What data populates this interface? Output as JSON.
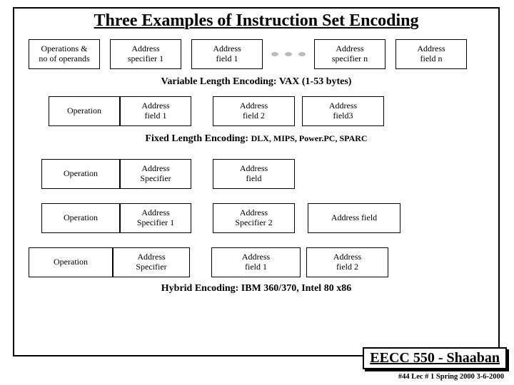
{
  "title_a": "Three Exam",
  "title_b": "ples of Instruction Set Encodin",
  "title_c": "g",
  "row1": {
    "c1a": "Operations &",
    "c1b": "no of operands",
    "c2a": "Address",
    "c2b": "specifier 1",
    "c3a": "Address",
    "c3b": "field 1",
    "c4a": "Address",
    "c4b": "specifier n",
    "c5a": "Address",
    "c5b": "field n"
  },
  "sub1": "Variable Length Encoding:  VAX  (1-53 bytes)",
  "row2": {
    "c1": "Operation",
    "c2a": "Address",
    "c2b": "field 1",
    "c3a": "Address",
    "c3b": "field 2",
    "c4a": "Address",
    "c4b": "field3"
  },
  "sub2a": "Fixed Length Encoding:",
  "sub2b": "DLX, MIPS, Power.PC, SPARC",
  "row3": {
    "c1": "Operation",
    "c2a": "Address",
    "c2b": "Specifier",
    "c3a": "Address",
    "c3b": "field"
  },
  "row4": {
    "c1": "Operation",
    "c2a": "Address",
    "c2b": "Specifier 1",
    "c3a": "Address",
    "c3b": "Specifier 2",
    "c4": "Address field"
  },
  "row5": {
    "c1": "Operation",
    "c2a": "Address",
    "c2b": "Specifier",
    "c3a": "Address",
    "c3b": "field 1",
    "c4a": "Address",
    "c4b": "field 2"
  },
  "sub3": "Hybrid Encoding: IBM 360/370,  Intel 80 x86",
  "footer_a": "EECC 550 - Shaaban",
  "footer_line": "#44   Lec # 1   Spring 2000  3-6-2000"
}
